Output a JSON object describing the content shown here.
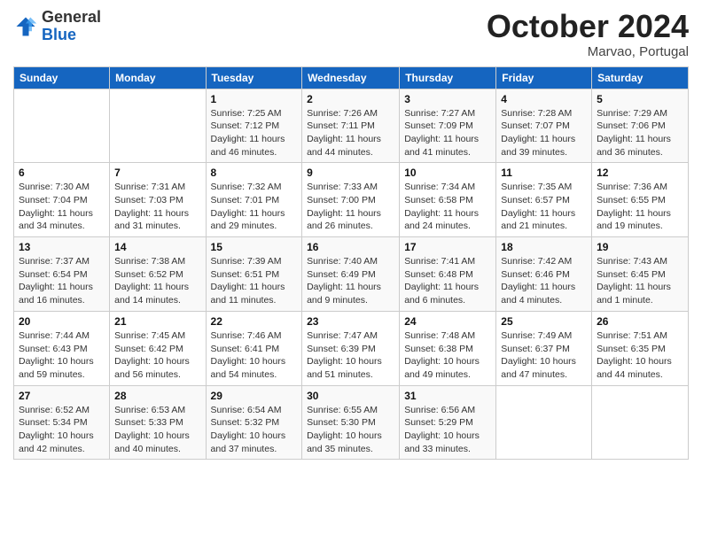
{
  "header": {
    "logo": {
      "general": "General",
      "blue": "Blue"
    },
    "month": "October 2024",
    "location": "Marvao, Portugal"
  },
  "weekdays": [
    "Sunday",
    "Monday",
    "Tuesday",
    "Wednesday",
    "Thursday",
    "Friday",
    "Saturday"
  ],
  "weeks": [
    [
      {
        "day": "",
        "info": ""
      },
      {
        "day": "",
        "info": ""
      },
      {
        "day": "1",
        "sunrise": "Sunrise: 7:25 AM",
        "sunset": "Sunset: 7:12 PM",
        "daylight": "Daylight: 11 hours and 46 minutes."
      },
      {
        "day": "2",
        "sunrise": "Sunrise: 7:26 AM",
        "sunset": "Sunset: 7:11 PM",
        "daylight": "Daylight: 11 hours and 44 minutes."
      },
      {
        "day": "3",
        "sunrise": "Sunrise: 7:27 AM",
        "sunset": "Sunset: 7:09 PM",
        "daylight": "Daylight: 11 hours and 41 minutes."
      },
      {
        "day": "4",
        "sunrise": "Sunrise: 7:28 AM",
        "sunset": "Sunset: 7:07 PM",
        "daylight": "Daylight: 11 hours and 39 minutes."
      },
      {
        "day": "5",
        "sunrise": "Sunrise: 7:29 AM",
        "sunset": "Sunset: 7:06 PM",
        "daylight": "Daylight: 11 hours and 36 minutes."
      }
    ],
    [
      {
        "day": "6",
        "sunrise": "Sunrise: 7:30 AM",
        "sunset": "Sunset: 7:04 PM",
        "daylight": "Daylight: 11 hours and 34 minutes."
      },
      {
        "day": "7",
        "sunrise": "Sunrise: 7:31 AM",
        "sunset": "Sunset: 7:03 PM",
        "daylight": "Daylight: 11 hours and 31 minutes."
      },
      {
        "day": "8",
        "sunrise": "Sunrise: 7:32 AM",
        "sunset": "Sunset: 7:01 PM",
        "daylight": "Daylight: 11 hours and 29 minutes."
      },
      {
        "day": "9",
        "sunrise": "Sunrise: 7:33 AM",
        "sunset": "Sunset: 7:00 PM",
        "daylight": "Daylight: 11 hours and 26 minutes."
      },
      {
        "day": "10",
        "sunrise": "Sunrise: 7:34 AM",
        "sunset": "Sunset: 6:58 PM",
        "daylight": "Daylight: 11 hours and 24 minutes."
      },
      {
        "day": "11",
        "sunrise": "Sunrise: 7:35 AM",
        "sunset": "Sunset: 6:57 PM",
        "daylight": "Daylight: 11 hours and 21 minutes."
      },
      {
        "day": "12",
        "sunrise": "Sunrise: 7:36 AM",
        "sunset": "Sunset: 6:55 PM",
        "daylight": "Daylight: 11 hours and 19 minutes."
      }
    ],
    [
      {
        "day": "13",
        "sunrise": "Sunrise: 7:37 AM",
        "sunset": "Sunset: 6:54 PM",
        "daylight": "Daylight: 11 hours and 16 minutes."
      },
      {
        "day": "14",
        "sunrise": "Sunrise: 7:38 AM",
        "sunset": "Sunset: 6:52 PM",
        "daylight": "Daylight: 11 hours and 14 minutes."
      },
      {
        "day": "15",
        "sunrise": "Sunrise: 7:39 AM",
        "sunset": "Sunset: 6:51 PM",
        "daylight": "Daylight: 11 hours and 11 minutes."
      },
      {
        "day": "16",
        "sunrise": "Sunrise: 7:40 AM",
        "sunset": "Sunset: 6:49 PM",
        "daylight": "Daylight: 11 hours and 9 minutes."
      },
      {
        "day": "17",
        "sunrise": "Sunrise: 7:41 AM",
        "sunset": "Sunset: 6:48 PM",
        "daylight": "Daylight: 11 hours and 6 minutes."
      },
      {
        "day": "18",
        "sunrise": "Sunrise: 7:42 AM",
        "sunset": "Sunset: 6:46 PM",
        "daylight": "Daylight: 11 hours and 4 minutes."
      },
      {
        "day": "19",
        "sunrise": "Sunrise: 7:43 AM",
        "sunset": "Sunset: 6:45 PM",
        "daylight": "Daylight: 11 hours and 1 minute."
      }
    ],
    [
      {
        "day": "20",
        "sunrise": "Sunrise: 7:44 AM",
        "sunset": "Sunset: 6:43 PM",
        "daylight": "Daylight: 10 hours and 59 minutes."
      },
      {
        "day": "21",
        "sunrise": "Sunrise: 7:45 AM",
        "sunset": "Sunset: 6:42 PM",
        "daylight": "Daylight: 10 hours and 56 minutes."
      },
      {
        "day": "22",
        "sunrise": "Sunrise: 7:46 AM",
        "sunset": "Sunset: 6:41 PM",
        "daylight": "Daylight: 10 hours and 54 minutes."
      },
      {
        "day": "23",
        "sunrise": "Sunrise: 7:47 AM",
        "sunset": "Sunset: 6:39 PM",
        "daylight": "Daylight: 10 hours and 51 minutes."
      },
      {
        "day": "24",
        "sunrise": "Sunrise: 7:48 AM",
        "sunset": "Sunset: 6:38 PM",
        "daylight": "Daylight: 10 hours and 49 minutes."
      },
      {
        "day": "25",
        "sunrise": "Sunrise: 7:49 AM",
        "sunset": "Sunset: 6:37 PM",
        "daylight": "Daylight: 10 hours and 47 minutes."
      },
      {
        "day": "26",
        "sunrise": "Sunrise: 7:51 AM",
        "sunset": "Sunset: 6:35 PM",
        "daylight": "Daylight: 10 hours and 44 minutes."
      }
    ],
    [
      {
        "day": "27",
        "sunrise": "Sunrise: 6:52 AM",
        "sunset": "Sunset: 5:34 PM",
        "daylight": "Daylight: 10 hours and 42 minutes."
      },
      {
        "day": "28",
        "sunrise": "Sunrise: 6:53 AM",
        "sunset": "Sunset: 5:33 PM",
        "daylight": "Daylight: 10 hours and 40 minutes."
      },
      {
        "day": "29",
        "sunrise": "Sunrise: 6:54 AM",
        "sunset": "Sunset: 5:32 PM",
        "daylight": "Daylight: 10 hours and 37 minutes."
      },
      {
        "day": "30",
        "sunrise": "Sunrise: 6:55 AM",
        "sunset": "Sunset: 5:30 PM",
        "daylight": "Daylight: 10 hours and 35 minutes."
      },
      {
        "day": "31",
        "sunrise": "Sunrise: 6:56 AM",
        "sunset": "Sunset: 5:29 PM",
        "daylight": "Daylight: 10 hours and 33 minutes."
      },
      {
        "day": "",
        "info": ""
      },
      {
        "day": "",
        "info": ""
      }
    ]
  ]
}
